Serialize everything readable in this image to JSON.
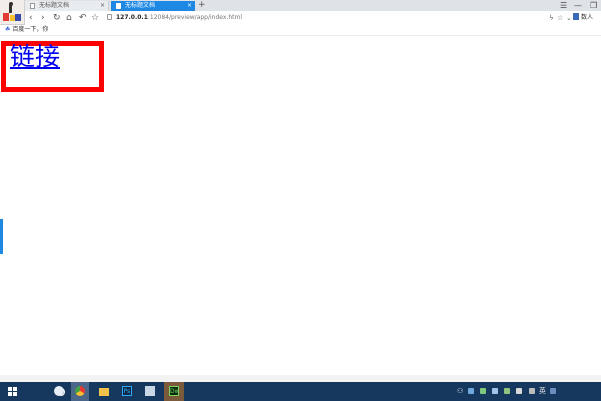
{
  "browser": {
    "tabs": [
      {
        "label": "无标题文档",
        "active": false
      },
      {
        "label": "无标题文档",
        "active": true
      }
    ],
    "new_tab_glyph": "+",
    "url": {
      "host": "127.0.0.1",
      "path": ":12084/preview/app/index.html"
    },
    "nav_glyphs": {
      "back": "‹",
      "forward": "›",
      "reload": "↻",
      "home": "⌂",
      "undo": "↶",
      "star": "☆"
    },
    "right_glyphs": {
      "lightning": "ϟ",
      "star": "☆",
      "chevron": "⌄"
    },
    "profile_label": "数人",
    "window_controls": {
      "menu": "☰",
      "minimize": "—",
      "restore": "❐"
    },
    "bookmarks": [
      {
        "icon": "baidu-paw-icon",
        "label": "百度一下，你"
      }
    ]
  },
  "page": {
    "link_text": "链接",
    "link_box_color": "#ff0000",
    "link_color": "#0000ee"
  },
  "taskbar": {
    "apps": [
      {
        "name": "file-explorer-icon"
      },
      {
        "name": "browser-icon"
      },
      {
        "name": "folder-icon"
      },
      {
        "name": "photoshop-icon",
        "label": "Ps"
      },
      {
        "name": "document-icon"
      },
      {
        "name": "dreamweaver-icon",
        "label": "Dw"
      }
    ],
    "ime_label": "英"
  },
  "colors": {
    "active_tab": "#1e88e5",
    "taskbar": "#16385e"
  }
}
